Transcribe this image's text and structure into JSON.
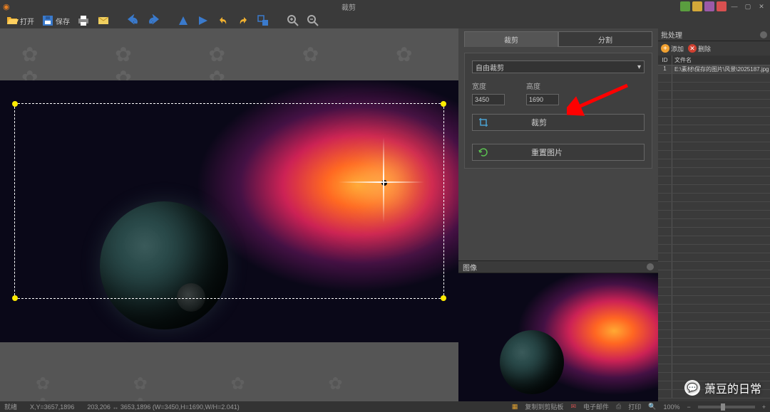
{
  "app": {
    "title": "裁剪"
  },
  "toolbar": {
    "open_label": "打开",
    "save_label": "保存"
  },
  "tabs": {
    "crop": "裁剪",
    "split": "分割"
  },
  "crop_panel": {
    "mode_label": "自由裁剪",
    "width_label": "宽度",
    "height_label": "高度",
    "width_value": "3450",
    "height_value": "1690",
    "crop_btn": "裁剪",
    "reset_btn": "重置图片"
  },
  "preview": {
    "header": "图像"
  },
  "file_panel": {
    "header": "批处理",
    "add_label": "添加",
    "delete_label": "删除",
    "col_id": "ID",
    "col_name": "文件名",
    "row1_id": "1",
    "row1_name": "E:\\素材\\保存的图片\\风景\\2025187.jpg"
  },
  "statusbar": {
    "ready": "就绪",
    "coords": "X,Y=3657,1896",
    "info": "203,206 ↔ 3653,1896 (W=3450,H=1690,W/H=2.041)",
    "copy_clip": "复制到剪贴板",
    "email": "电子邮件",
    "print": "打印",
    "zoom": "100%"
  },
  "watermark": "萧豆的日常"
}
